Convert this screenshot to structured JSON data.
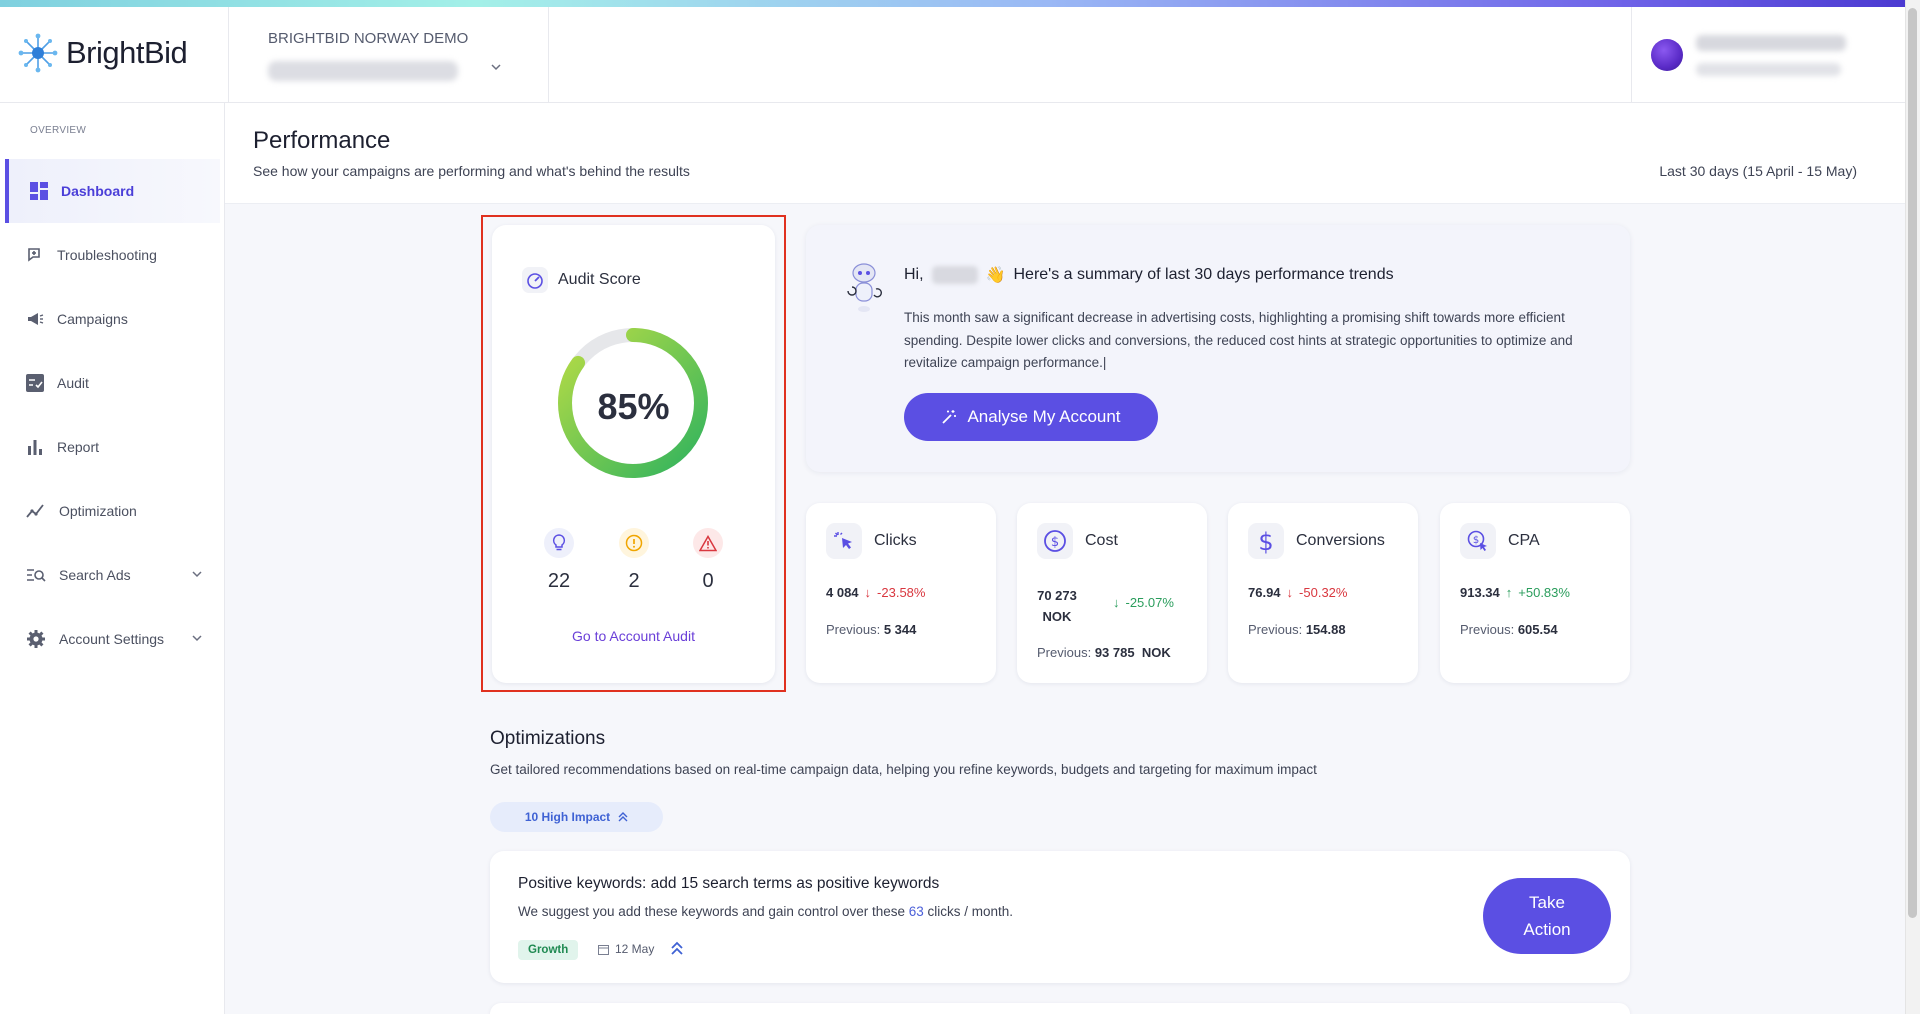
{
  "app": {
    "logo_text": "BrightBid"
  },
  "header": {
    "account_label": "BRIGHTBID NORWAY DEMO"
  },
  "sidebar": {
    "section_caption": "OVERVIEW",
    "items": [
      {
        "label": "Dashboard",
        "icon": "dashboard-icon",
        "active": true
      },
      {
        "label": "Troubleshooting",
        "icon": "troubleshooting-icon"
      },
      {
        "label": "Campaigns",
        "icon": "megaphone-icon"
      },
      {
        "label": "Audit",
        "icon": "audit-checklist-icon"
      },
      {
        "label": "Report",
        "icon": "bar-chart-icon"
      },
      {
        "label": "Optimization",
        "icon": "trend-line-icon"
      },
      {
        "label": "Search Ads",
        "icon": "search-list-icon",
        "expandable": true
      },
      {
        "label": "Account Settings",
        "icon": "gear-icon",
        "expandable": true
      }
    ]
  },
  "page": {
    "title": "Performance",
    "subtitle": "See how your campaigns are performing and what's behind the results",
    "date_range": "Last 30 days (15 April - 15 May)"
  },
  "audit": {
    "title": "Audit Score",
    "score_text": "85%",
    "score_value": 0.85,
    "metrics": [
      {
        "icon": "lightbulb-icon",
        "value": "22"
      },
      {
        "icon": "warning-circle-icon",
        "value": "2"
      },
      {
        "icon": "alert-triangle-icon",
        "value": "0"
      }
    ],
    "link_label": "Go to Account Audit"
  },
  "summary": {
    "greeting": "Hi,",
    "wave": "👋",
    "headline": "Here's a summary of last 30 days performance trends",
    "body": "This month saw a significant decrease in advertising costs, highlighting a promising shift towards more efficient spending. Despite lower clicks and conversions, the reduced cost hints at strategic opportunities to optimize and revitalize campaign performance.|",
    "button_label": "Analyse My Account"
  },
  "kpis": [
    {
      "label": "Clicks",
      "icon": "cursor-click-icon",
      "value": "4 084",
      "change": "-23.58%",
      "direction": "down",
      "prev_label": "Previous:",
      "prev_value": "5 344"
    },
    {
      "label": "Cost",
      "icon": "dollar-circle-icon",
      "value_line1": "70 273",
      "value_line2": "NOK",
      "change": "-25.07%",
      "direction": "down",
      "prev_label": "Previous:",
      "prev_value": "93 785",
      "prev_unit": "NOK"
    },
    {
      "label": "Conversions",
      "icon": "dollar-icon",
      "value": "76.94",
      "change": "-50.32%",
      "direction": "down",
      "prev_label": "Previous:",
      "prev_value": "154.88"
    },
    {
      "label": "CPA",
      "icon": "cpa-search-dollar-icon",
      "value": "913.34",
      "change": "+50.83%",
      "direction": "up",
      "prev_label": "Previous:",
      "prev_value": "605.54"
    }
  ],
  "optimizations": {
    "title": "Optimizations",
    "subtitle": "Get tailored recommendations based on real-time campaign data, helping you refine keywords, budgets and targeting for maximum impact",
    "filter_pill": "10 High Impact",
    "recommendation": {
      "title": "Positive keywords: add 15 search terms as positive keywords",
      "desc_before": "We suggest you add these keywords and gain control over these ",
      "desc_link": "63",
      "desc_after": " clicks / month.",
      "tag": "Growth",
      "date": "12 May",
      "button_line1": "Take",
      "button_line2": "Action"
    }
  },
  "colors": {
    "accent": "#5b4fe3",
    "negative": "#d9373f",
    "positive": "#2a9d5c",
    "highlight_border": "#e0311f"
  }
}
